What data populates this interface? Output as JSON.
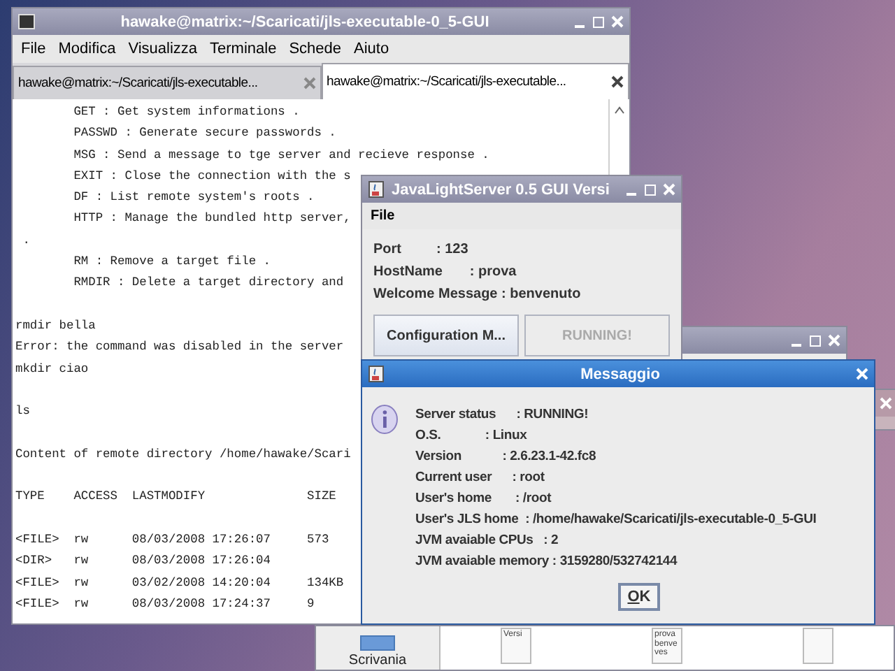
{
  "terminal": {
    "title": "hawake@matrix:~/Scaricati/jls-executable-0_5-GUI",
    "menu": [
      "File",
      "Modifica",
      "Visualizza",
      "Terminale",
      "Schede",
      "Aiuto"
    ],
    "tabs": [
      {
        "label": "hawake@matrix:~/Scaricati/jls-executable...",
        "selected": false
      },
      {
        "label": "hawake@matrix:~/Scaricati/jls-executable...",
        "selected": true
      }
    ],
    "blocks": [
      [
        {
          "kind": "command",
          "text": "GET : Get system informations ."
        },
        {
          "kind": "command",
          "text": "PASSWD : Generate secure passwords ."
        },
        {
          "kind": "command",
          "text": "MSG : Send a message to tge server and recieve response ."
        },
        {
          "kind": "command",
          "text": "EXIT : Close the connection with the s"
        },
        {
          "kind": "command",
          "text": "DF : List remote system's roots ."
        },
        {
          "kind": "command",
          "text": "HTTP : Manage the bundled http server,"
        },
        {
          "kind": "continuation",
          "text": "."
        },
        {
          "kind": "command",
          "text": "RM : Remove a target file ."
        },
        {
          "kind": "command",
          "text": "RMDIR : Delete a target directory and"
        }
      ],
      [
        {
          "kind": "plain",
          "text": "rmdir bella"
        },
        {
          "kind": "plain",
          "text": "Error: the command was disabled in the server"
        },
        {
          "kind": "plain",
          "text": "mkdir ciao"
        }
      ],
      [
        {
          "kind": "plain",
          "text": "ls"
        }
      ],
      [
        {
          "kind": "plain",
          "text": "Content of remote directory /home/hawake/Scari"
        }
      ]
    ],
    "listing": {
      "columns": [
        "TYPE",
        "ACCESS",
        "LASTMODIFY",
        "SIZE"
      ],
      "rows": [
        [
          "<FILE>",
          "rw",
          "08/03/2008 17:26:07",
          "573"
        ],
        [
          "<DIR>",
          "rw",
          "08/03/2008 17:26:04"
        ],
        [
          "<FILE>",
          "rw",
          "03/02/2008 14:20:04",
          "134KB"
        ],
        [
          "<FILE>",
          "rw",
          "08/03/2008 17:24:37",
          "9"
        ]
      ]
    }
  },
  "jls_window": {
    "title": "JavaLightServer 0.5 GUI Versi",
    "menu": [
      "File"
    ],
    "fields": [
      "Port         : 123",
      "HostName       : prova",
      "Welcome Message : benvenuto"
    ],
    "buttons": [
      {
        "label": "Configuration M...",
        "disabled": false
      },
      {
        "label": "RUNNING!",
        "disabled": true
      }
    ]
  },
  "file_manager": {
    "sidebar_item": "Scrivania",
    "thumbnails": [
      [
        "Versi"
      ],
      [
        "prova",
        "benve",
        "ves"
      ]
    ]
  },
  "dialog": {
    "title": "Messaggio",
    "lines": [
      "Server status      : RUNNING!",
      "O.S.             : Linux",
      "Version            : 2.6.23.1-42.fc8",
      "Current user      : root",
      "User's home       : /root",
      "User's JLS home  : /home/hawake/Scaricati/jls-executable-0_5-GUI",
      "JVM avaiable CPUs   : 2",
      "JVM avaiable memory : 3159280/532742144"
    ],
    "button": "OK"
  }
}
